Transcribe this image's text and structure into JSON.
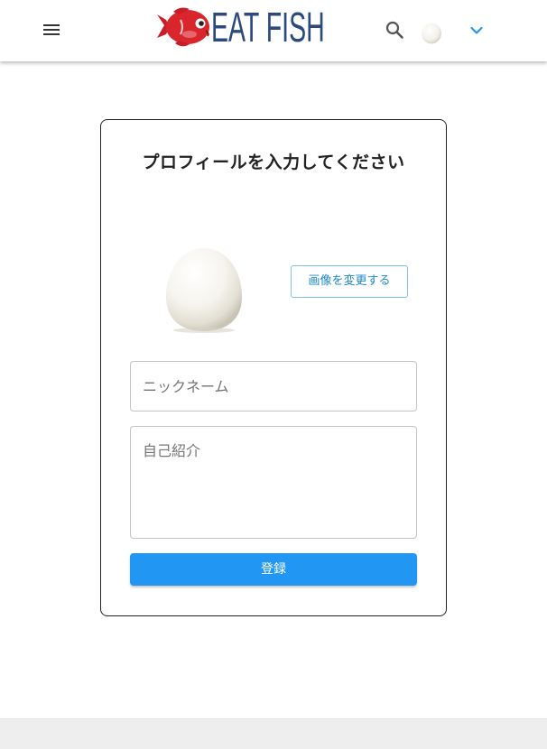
{
  "header": {
    "menu_icon": "hamburger-menu-icon",
    "logo_text": "EAT FISH",
    "search_icon": "search-icon",
    "chevron_icon": "chevron-down-icon"
  },
  "profile_form": {
    "title": "プロフィールを入力してください",
    "change_image_label": "画像を変更する",
    "nickname_placeholder": "ニックネーム",
    "nickname_value": "",
    "bio_placeholder": "自己紹介",
    "bio_value": "",
    "submit_label": "登録"
  },
  "colors": {
    "primary": "#2196f3",
    "outline_button_text": "#1e88c8",
    "logo_text": "#2c4a7c",
    "logo_fish": "#d9262c"
  }
}
